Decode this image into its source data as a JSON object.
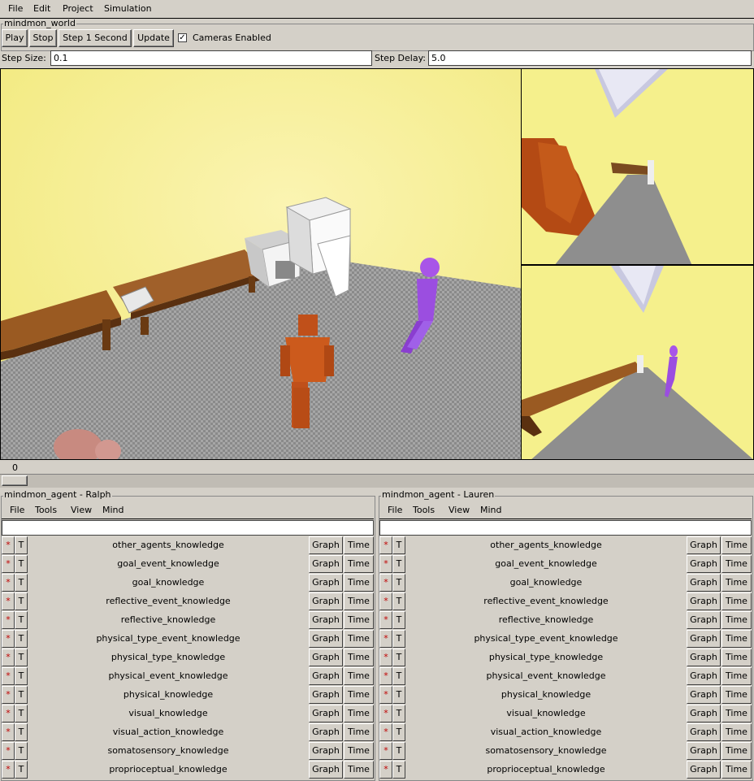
{
  "menubar": {
    "items": [
      "File",
      "Edit",
      "Project",
      "Simulation"
    ]
  },
  "world": {
    "title": "mindmon_world",
    "play": "Play",
    "stop": "Stop",
    "step": "Step 1 Second",
    "update": "Update",
    "cameras_label": "Cameras Enabled",
    "cameras_checked": true,
    "step_size_label": "Step Size:",
    "step_size_value": "0.1",
    "step_delay_label": "Step Delay:",
    "step_delay_value": "5.0",
    "time_value": "0"
  },
  "agents": [
    {
      "title": "mindmon_agent - Ralph",
      "menu": [
        "File",
        "Tools",
        "View",
        "Mind"
      ],
      "command": "",
      "rows": [
        "other_agents_knowledge",
        "goal_event_knowledge",
        "goal_knowledge",
        "reflective_event_knowledge",
        "reflective_knowledge",
        "physical_type_event_knowledge",
        "physical_type_knowledge",
        "physical_event_knowledge",
        "physical_knowledge",
        "visual_knowledge",
        "visual_action_knowledge",
        "somatosensory_knowledge",
        "proprioceptual_knowledge"
      ]
    },
    {
      "title": "mindmon_agent - Lauren",
      "menu": [
        "File",
        "Tools",
        "View",
        "Mind"
      ],
      "command": "",
      "rows": [
        "other_agents_knowledge",
        "goal_event_knowledge",
        "goal_knowledge",
        "reflective_event_knowledge",
        "reflective_knowledge",
        "physical_type_event_knowledge",
        "physical_type_knowledge",
        "physical_event_knowledge",
        "physical_knowledge",
        "visual_knowledge",
        "visual_action_knowledge",
        "somatosensory_knowledge",
        "proprioceptual_knowledge"
      ]
    }
  ],
  "row_buttons": {
    "star": "*",
    "t": "T",
    "graph": "Graph",
    "time": "Time"
  }
}
